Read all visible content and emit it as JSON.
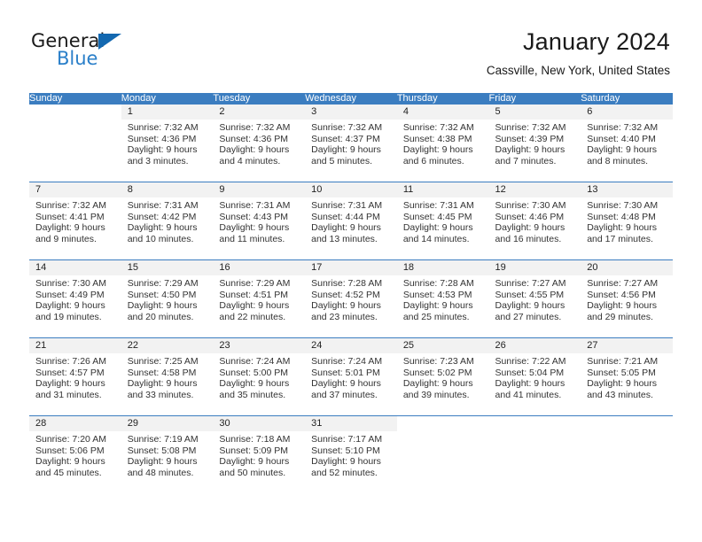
{
  "brand": {
    "name_part1": "General",
    "name_part2": "Blue",
    "logo_icon": "triangle-logo-icon",
    "accent_color": "#1368b0"
  },
  "header": {
    "month_title": "January 2024",
    "location": "Cassville, New York, United States"
  },
  "theme": {
    "header_row_color": "#3b7dc0",
    "day_band_color": "#f2f2f2",
    "text_color": "#333333"
  },
  "weekday_headers": [
    "Sunday",
    "Monday",
    "Tuesday",
    "Wednesday",
    "Thursday",
    "Friday",
    "Saturday"
  ],
  "weeks": [
    [
      {
        "day": "",
        "lines": []
      },
      {
        "day": "1",
        "lines": [
          "Sunrise: 7:32 AM",
          "Sunset: 4:36 PM",
          "Daylight: 9 hours",
          "and 3 minutes."
        ]
      },
      {
        "day": "2",
        "lines": [
          "Sunrise: 7:32 AM",
          "Sunset: 4:36 PM",
          "Daylight: 9 hours",
          "and 4 minutes."
        ]
      },
      {
        "day": "3",
        "lines": [
          "Sunrise: 7:32 AM",
          "Sunset: 4:37 PM",
          "Daylight: 9 hours",
          "and 5 minutes."
        ]
      },
      {
        "day": "4",
        "lines": [
          "Sunrise: 7:32 AM",
          "Sunset: 4:38 PM",
          "Daylight: 9 hours",
          "and 6 minutes."
        ]
      },
      {
        "day": "5",
        "lines": [
          "Sunrise: 7:32 AM",
          "Sunset: 4:39 PM",
          "Daylight: 9 hours",
          "and 7 minutes."
        ]
      },
      {
        "day": "6",
        "lines": [
          "Sunrise: 7:32 AM",
          "Sunset: 4:40 PM",
          "Daylight: 9 hours",
          "and 8 minutes."
        ]
      }
    ],
    [
      {
        "day": "7",
        "lines": [
          "Sunrise: 7:32 AM",
          "Sunset: 4:41 PM",
          "Daylight: 9 hours",
          "and 9 minutes."
        ]
      },
      {
        "day": "8",
        "lines": [
          "Sunrise: 7:31 AM",
          "Sunset: 4:42 PM",
          "Daylight: 9 hours",
          "and 10 minutes."
        ]
      },
      {
        "day": "9",
        "lines": [
          "Sunrise: 7:31 AM",
          "Sunset: 4:43 PM",
          "Daylight: 9 hours",
          "and 11 minutes."
        ]
      },
      {
        "day": "10",
        "lines": [
          "Sunrise: 7:31 AM",
          "Sunset: 4:44 PM",
          "Daylight: 9 hours",
          "and 13 minutes."
        ]
      },
      {
        "day": "11",
        "lines": [
          "Sunrise: 7:31 AM",
          "Sunset: 4:45 PM",
          "Daylight: 9 hours",
          "and 14 minutes."
        ]
      },
      {
        "day": "12",
        "lines": [
          "Sunrise: 7:30 AM",
          "Sunset: 4:46 PM",
          "Daylight: 9 hours",
          "and 16 minutes."
        ]
      },
      {
        "day": "13",
        "lines": [
          "Sunrise: 7:30 AM",
          "Sunset: 4:48 PM",
          "Daylight: 9 hours",
          "and 17 minutes."
        ]
      }
    ],
    [
      {
        "day": "14",
        "lines": [
          "Sunrise: 7:30 AM",
          "Sunset: 4:49 PM",
          "Daylight: 9 hours",
          "and 19 minutes."
        ]
      },
      {
        "day": "15",
        "lines": [
          "Sunrise: 7:29 AM",
          "Sunset: 4:50 PM",
          "Daylight: 9 hours",
          "and 20 minutes."
        ]
      },
      {
        "day": "16",
        "lines": [
          "Sunrise: 7:29 AM",
          "Sunset: 4:51 PM",
          "Daylight: 9 hours",
          "and 22 minutes."
        ]
      },
      {
        "day": "17",
        "lines": [
          "Sunrise: 7:28 AM",
          "Sunset: 4:52 PM",
          "Daylight: 9 hours",
          "and 23 minutes."
        ]
      },
      {
        "day": "18",
        "lines": [
          "Sunrise: 7:28 AM",
          "Sunset: 4:53 PM",
          "Daylight: 9 hours",
          "and 25 minutes."
        ]
      },
      {
        "day": "19",
        "lines": [
          "Sunrise: 7:27 AM",
          "Sunset: 4:55 PM",
          "Daylight: 9 hours",
          "and 27 minutes."
        ]
      },
      {
        "day": "20",
        "lines": [
          "Sunrise: 7:27 AM",
          "Sunset: 4:56 PM",
          "Daylight: 9 hours",
          "and 29 minutes."
        ]
      }
    ],
    [
      {
        "day": "21",
        "lines": [
          "Sunrise: 7:26 AM",
          "Sunset: 4:57 PM",
          "Daylight: 9 hours",
          "and 31 minutes."
        ]
      },
      {
        "day": "22",
        "lines": [
          "Sunrise: 7:25 AM",
          "Sunset: 4:58 PM",
          "Daylight: 9 hours",
          "and 33 minutes."
        ]
      },
      {
        "day": "23",
        "lines": [
          "Sunrise: 7:24 AM",
          "Sunset: 5:00 PM",
          "Daylight: 9 hours",
          "and 35 minutes."
        ]
      },
      {
        "day": "24",
        "lines": [
          "Sunrise: 7:24 AM",
          "Sunset: 5:01 PM",
          "Daylight: 9 hours",
          "and 37 minutes."
        ]
      },
      {
        "day": "25",
        "lines": [
          "Sunrise: 7:23 AM",
          "Sunset: 5:02 PM",
          "Daylight: 9 hours",
          "and 39 minutes."
        ]
      },
      {
        "day": "26",
        "lines": [
          "Sunrise: 7:22 AM",
          "Sunset: 5:04 PM",
          "Daylight: 9 hours",
          "and 41 minutes."
        ]
      },
      {
        "day": "27",
        "lines": [
          "Sunrise: 7:21 AM",
          "Sunset: 5:05 PM",
          "Daylight: 9 hours",
          "and 43 minutes."
        ]
      }
    ],
    [
      {
        "day": "28",
        "lines": [
          "Sunrise: 7:20 AM",
          "Sunset: 5:06 PM",
          "Daylight: 9 hours",
          "and 45 minutes."
        ]
      },
      {
        "day": "29",
        "lines": [
          "Sunrise: 7:19 AM",
          "Sunset: 5:08 PM",
          "Daylight: 9 hours",
          "and 48 minutes."
        ]
      },
      {
        "day": "30",
        "lines": [
          "Sunrise: 7:18 AM",
          "Sunset: 5:09 PM",
          "Daylight: 9 hours",
          "and 50 minutes."
        ]
      },
      {
        "day": "31",
        "lines": [
          "Sunrise: 7:17 AM",
          "Sunset: 5:10 PM",
          "Daylight: 9 hours",
          "and 52 minutes."
        ]
      },
      {
        "day": "",
        "lines": []
      },
      {
        "day": "",
        "lines": []
      },
      {
        "day": "",
        "lines": []
      }
    ]
  ]
}
